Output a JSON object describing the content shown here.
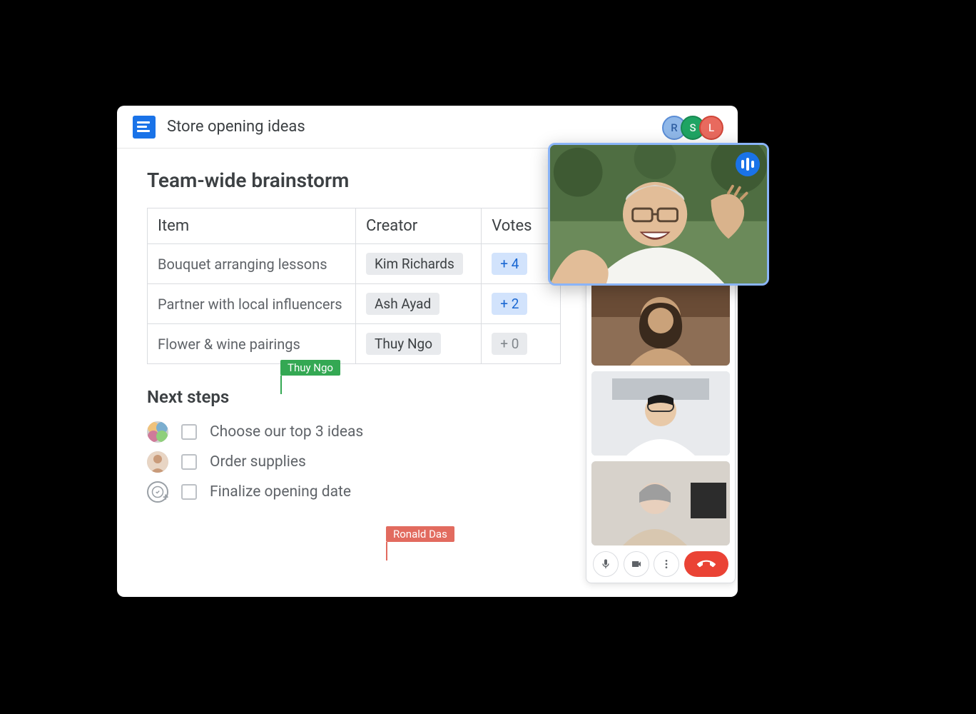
{
  "header": {
    "title": "Store opening ideas",
    "collaborators": [
      {
        "initial": "R",
        "color": "r"
      },
      {
        "initial": "S",
        "color": "s"
      },
      {
        "initial": "L",
        "color": "l"
      }
    ]
  },
  "doc": {
    "heading": "Team-wide brainstorm",
    "table": {
      "columns": {
        "item": "Item",
        "creator": "Creator",
        "votes": "Votes"
      },
      "rows": [
        {
          "item": "Bouquet arranging lessons",
          "creator": "Kim Richards",
          "votes_prefix": "+ ",
          "votes": "4",
          "votes_style": "active"
        },
        {
          "item": "Partner with local influencers",
          "creator": "Ash Ayad",
          "votes_prefix": "+ ",
          "votes": "2",
          "votes_style": "active"
        },
        {
          "item": "Flower & wine pairings",
          "creator": "Thuy Ngo",
          "votes_prefix": "+ ",
          "votes": "0",
          "votes_style": "zero"
        }
      ]
    },
    "cursors": {
      "green": {
        "name": "Thuy Ngo"
      },
      "red": {
        "name": "Ronald Das"
      }
    },
    "next_steps": {
      "heading": "Next steps",
      "items": [
        {
          "label": "Choose our top 3 ideas"
        },
        {
          "label": "Order supplies"
        },
        {
          "label": "Finalize opening date"
        }
      ]
    }
  },
  "call": {
    "controls": {
      "mic": "mic",
      "cam": "cam",
      "more": "more",
      "hangup": "hangup"
    }
  }
}
